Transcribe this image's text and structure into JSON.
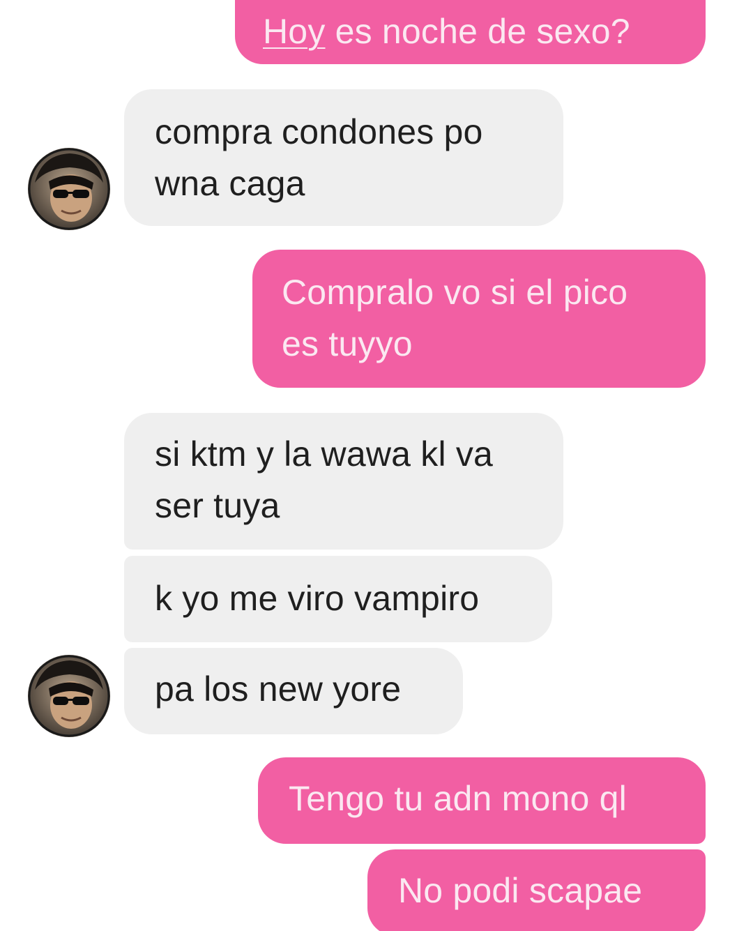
{
  "conversation": {
    "messages": [
      {
        "sender": "me",
        "lines": [
          "Hoy",
          " es noche de sexo?"
        ]
      },
      {
        "sender": "contact",
        "lines": [
          "compra condones po",
          "wna caga"
        ]
      },
      {
        "sender": "me",
        "lines": [
          "Compralo vo si el pico",
          "es tuyyo"
        ]
      },
      {
        "sender": "contact",
        "lines": [
          "si ktm y la wawa kl va",
          "ser tuya"
        ]
      },
      {
        "sender": "contact",
        "lines": [
          "k yo me viro vampiro"
        ]
      },
      {
        "sender": "contact",
        "lines": [
          "pa los new yore"
        ]
      },
      {
        "sender": "me",
        "lines": [
          "Tengo tu adn mono ql"
        ]
      },
      {
        "sender": "me",
        "lines": [
          "No podi scapae"
        ]
      }
    ]
  },
  "avatar": {
    "icon": "contact-avatar-photo"
  },
  "colors": {
    "outgoing_bubble": "#f25fa3",
    "outgoing_text": "#fbe8f1",
    "incoming_bubble": "#efefef",
    "incoming_text": "#1f1f1f"
  }
}
